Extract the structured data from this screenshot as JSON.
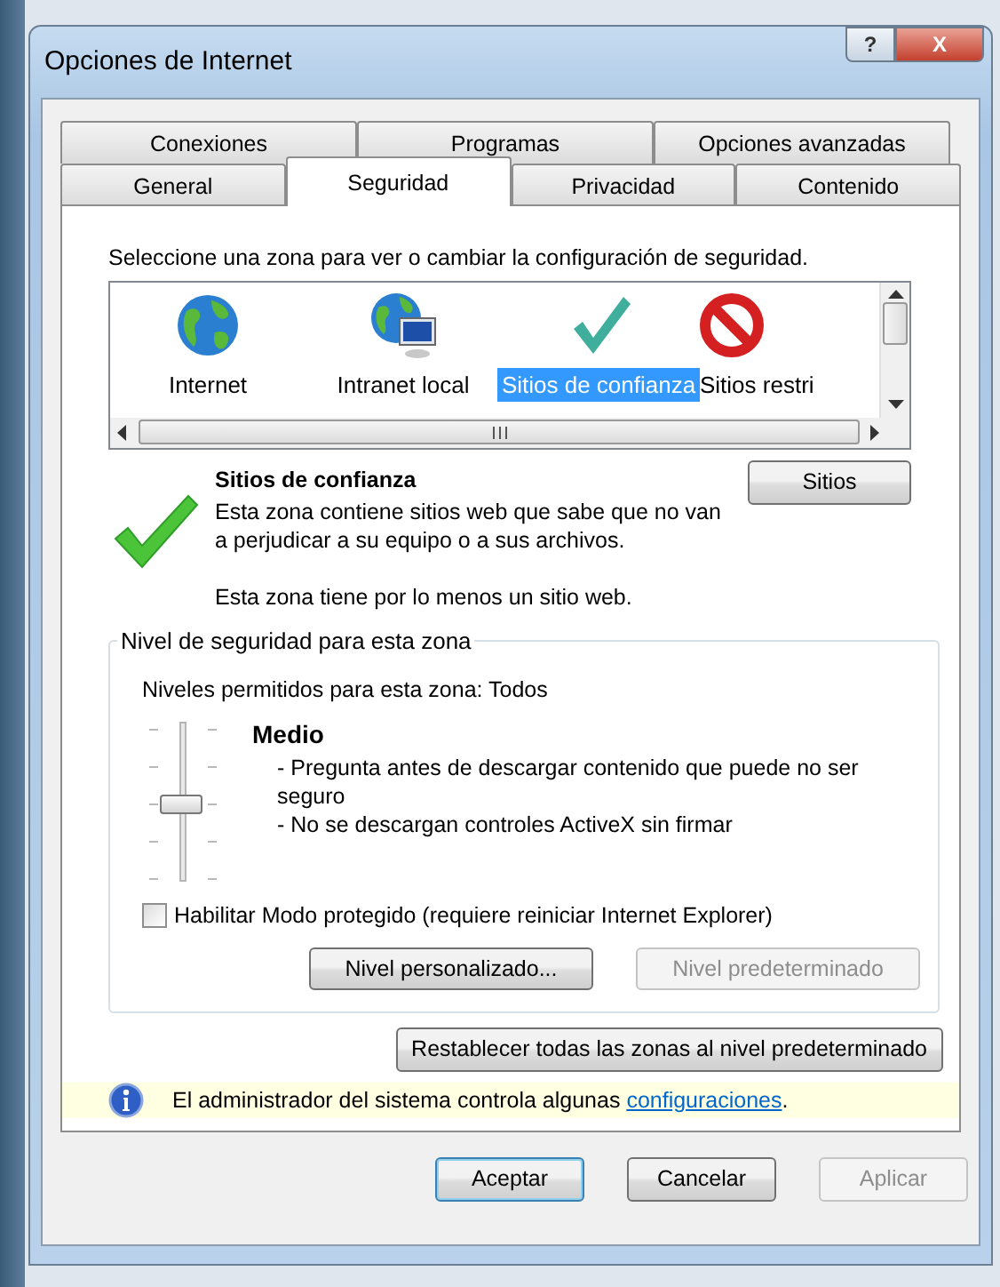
{
  "window": {
    "title": "Opciones de Internet",
    "title_buttons": [
      "?",
      "X"
    ]
  },
  "tab_rows": [
    [
      {
        "label": "Conexiones",
        "selected": false
      },
      {
        "label": "Programas",
        "selected": false
      },
      {
        "label": "Opciones avanzadas",
        "selected": false
      }
    ],
    [
      {
        "label": "General",
        "selected": false
      },
      {
        "label": "Seguridad",
        "selected": true
      },
      {
        "label": "Privacidad",
        "selected": false
      },
      {
        "label": "Contenido",
        "selected": false
      }
    ]
  ],
  "zone_prompt": "Seleccione una zona para ver o cambiar la configuración de seguridad.",
  "zones": [
    {
      "label": "Internet",
      "kind": "globe",
      "selected": false
    },
    {
      "label": "Intranet local",
      "kind": "intranet",
      "selected": false
    },
    {
      "label": "Sitios de confianza",
      "kind": "trusted",
      "selected": true
    },
    {
      "label": "Sitios restri",
      "kind": "restricted",
      "selected": false
    }
  ],
  "zone_info": {
    "title": "Sitios de confianza",
    "description": "Esta zona contiene sitios web que sabe que no van a perjudicar a su equipo o a sus archivos.",
    "note": "Esta zona tiene por lo menos un sitio web.",
    "sites_button": "Sitios"
  },
  "security_level": {
    "legend": "Nivel de seguridad para esta zona",
    "allowed": "Niveles permitidos para esta zona: Todos",
    "level": 0.5,
    "name": "Medio",
    "details": [
      "- Pregunta antes de descargar contenido que puede no ser seguro",
      "- No se descargan controles ActiveX sin firmar"
    ],
    "protected_mode": {
      "label": "Habilitar Modo protegido (requiere reiniciar Internet Explorer)",
      "checked": false
    },
    "buttons": [
      {
        "label": "Nivel personalizado...",
        "disabled": false
      },
      {
        "label": "Nivel predeterminado",
        "disabled": true
      }
    ]
  },
  "reset_button": "Restablecer todas las zonas al nivel predeterminado",
  "info_bar": {
    "text": "El administrador del sistema controla algunas ",
    "link": "configuraciones",
    "after": "."
  },
  "footer_buttons": [
    {
      "label": "Aceptar",
      "disabled": false,
      "default": true
    },
    {
      "label": "Cancelar",
      "disabled": false,
      "default": false
    },
    {
      "label": "Aplicar",
      "disabled": true,
      "default": false
    }
  ]
}
